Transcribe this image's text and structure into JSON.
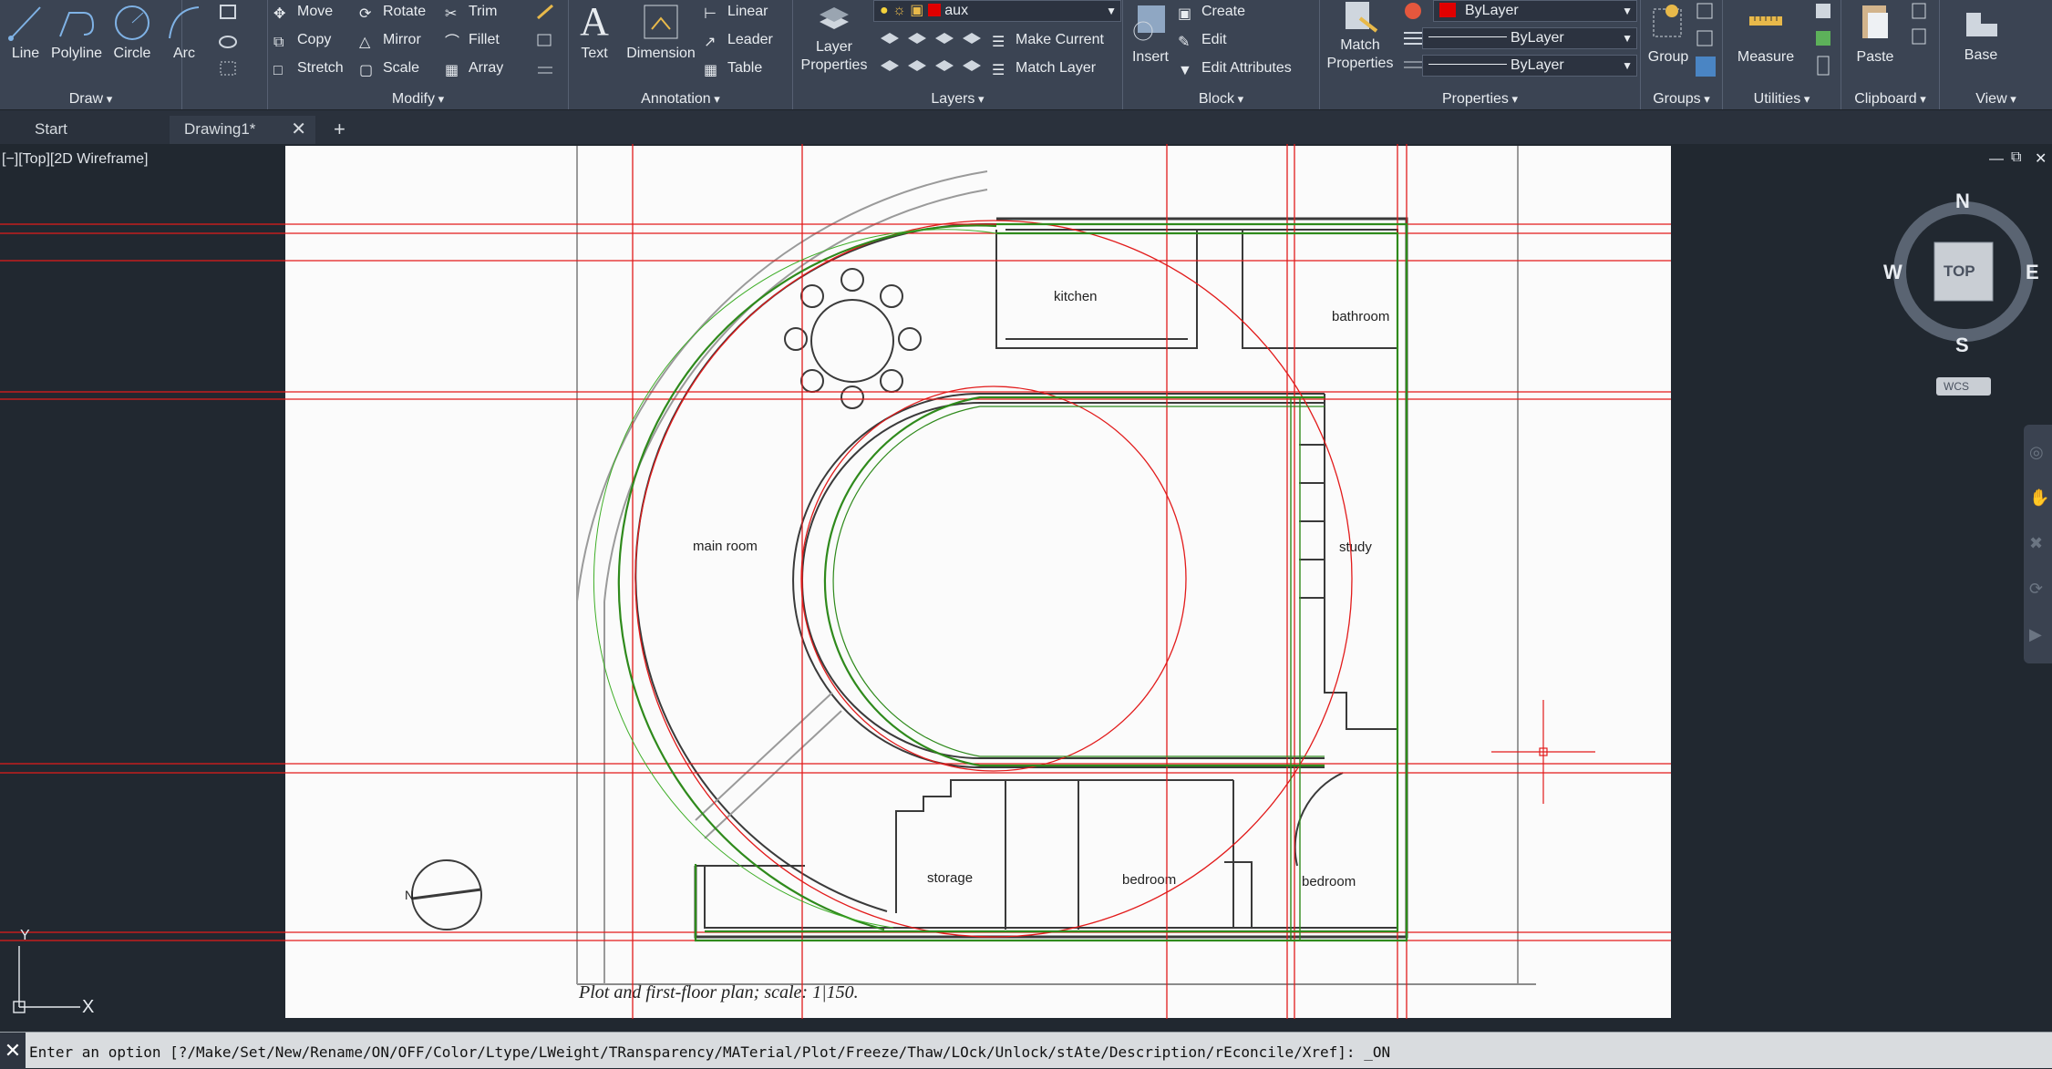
{
  "ribbon": {
    "draw": {
      "title": "Draw",
      "line": "Line",
      "polyline": "Polyline",
      "circle": "Circle",
      "arc": "Arc"
    },
    "modify": {
      "title": "Modify",
      "move": "Move",
      "rotate": "Rotate",
      "trim": "Trim",
      "copy": "Copy",
      "mirror": "Mirror",
      "fillet": "Fillet",
      "stretch": "Stretch",
      "scale": "Scale",
      "array": "Array"
    },
    "annotation": {
      "title": "Annotation",
      "text": "Text",
      "dimension": "Dimension",
      "linear": "Linear",
      "leader": "Leader",
      "table": "Table"
    },
    "layers": {
      "title": "Layers",
      "layer_properties_l1": "Layer",
      "layer_properties_l2": "Properties",
      "current_layer": "aux",
      "current_layer_color": "#e00000",
      "make_current": "Make Current",
      "match_layer": "Match Layer"
    },
    "block": {
      "title": "Block",
      "insert": "Insert",
      "create": "Create",
      "edit": "Edit",
      "edit_attributes": "Edit Attributes"
    },
    "properties": {
      "title": "Properties",
      "match_l1": "Match",
      "match_l2": "Properties",
      "color": "ByLayer",
      "linetype": "ByLayer",
      "lineweight": "ByLayer",
      "color_swatch": "#e00000"
    },
    "groups": {
      "title": "Groups",
      "group": "Group"
    },
    "utilities": {
      "title": "Utilities",
      "measure": "Measure"
    },
    "clipboard": {
      "title": "Clipboard",
      "paste": "Paste"
    },
    "view": {
      "title": "View",
      "base": "Base"
    }
  },
  "tabs": [
    {
      "label": "Start"
    },
    {
      "label": "Drawing1*"
    }
  ],
  "viewport": {
    "label": "[−][Top][2D Wireframe]",
    "viewcube": {
      "n": "N",
      "s": "S",
      "e": "E",
      "w": "W",
      "top": "TOP",
      "wcs": "WCS"
    },
    "drawing": {
      "kitchen": "kitchen",
      "bathroom": "bathroom",
      "main_room": "main room",
      "study": "study",
      "storage": "storage",
      "bedroom_1": "bedroom",
      "bedroom_2": "bedroom",
      "north": "N",
      "caption": "Plot and first-floor plan; scale:   1|150."
    },
    "ucs": {
      "y": "Y",
      "x": "X"
    }
  },
  "command_line": {
    "text": "Enter an option [?/Make/Set/New/Rename/ON/OFF/Color/Ltype/LWeight/TRansparency/MATerial/Plot/Freeze/Thaw/LOck/Unlock/stAte/Description/rEconcile/Xref]: _ON"
  },
  "colors": {
    "ribbon": "#3b4453",
    "canvas": "#212830",
    "red_aux": "#e21b1b",
    "green_trace": "#2f8a1c",
    "paper": "#fbfbfb"
  }
}
